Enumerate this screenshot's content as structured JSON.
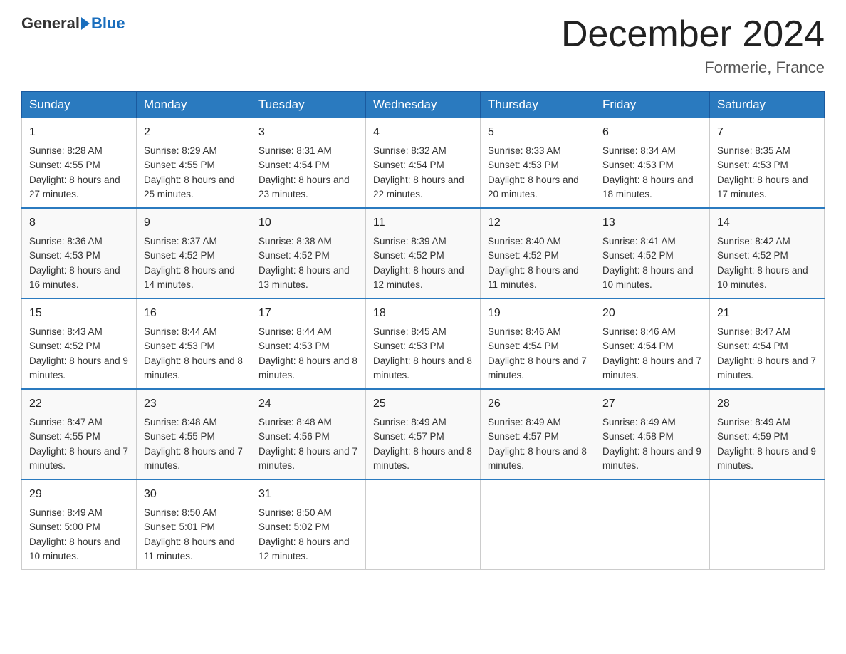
{
  "header": {
    "logo_general": "General",
    "logo_blue": "Blue",
    "month_title": "December 2024",
    "location": "Formerie, France"
  },
  "days_of_week": [
    "Sunday",
    "Monday",
    "Tuesday",
    "Wednesday",
    "Thursday",
    "Friday",
    "Saturday"
  ],
  "weeks": [
    [
      {
        "day": "1",
        "sunrise": "8:28 AM",
        "sunset": "4:55 PM",
        "daylight": "8 hours and 27 minutes."
      },
      {
        "day": "2",
        "sunrise": "8:29 AM",
        "sunset": "4:55 PM",
        "daylight": "8 hours and 25 minutes."
      },
      {
        "day": "3",
        "sunrise": "8:31 AM",
        "sunset": "4:54 PM",
        "daylight": "8 hours and 23 minutes."
      },
      {
        "day": "4",
        "sunrise": "8:32 AM",
        "sunset": "4:54 PM",
        "daylight": "8 hours and 22 minutes."
      },
      {
        "day": "5",
        "sunrise": "8:33 AM",
        "sunset": "4:53 PM",
        "daylight": "8 hours and 20 minutes."
      },
      {
        "day": "6",
        "sunrise": "8:34 AM",
        "sunset": "4:53 PM",
        "daylight": "8 hours and 18 minutes."
      },
      {
        "day": "7",
        "sunrise": "8:35 AM",
        "sunset": "4:53 PM",
        "daylight": "8 hours and 17 minutes."
      }
    ],
    [
      {
        "day": "8",
        "sunrise": "8:36 AM",
        "sunset": "4:53 PM",
        "daylight": "8 hours and 16 minutes."
      },
      {
        "day": "9",
        "sunrise": "8:37 AM",
        "sunset": "4:52 PM",
        "daylight": "8 hours and 14 minutes."
      },
      {
        "day": "10",
        "sunrise": "8:38 AM",
        "sunset": "4:52 PM",
        "daylight": "8 hours and 13 minutes."
      },
      {
        "day": "11",
        "sunrise": "8:39 AM",
        "sunset": "4:52 PM",
        "daylight": "8 hours and 12 minutes."
      },
      {
        "day": "12",
        "sunrise": "8:40 AM",
        "sunset": "4:52 PM",
        "daylight": "8 hours and 11 minutes."
      },
      {
        "day": "13",
        "sunrise": "8:41 AM",
        "sunset": "4:52 PM",
        "daylight": "8 hours and 10 minutes."
      },
      {
        "day": "14",
        "sunrise": "8:42 AM",
        "sunset": "4:52 PM",
        "daylight": "8 hours and 10 minutes."
      }
    ],
    [
      {
        "day": "15",
        "sunrise": "8:43 AM",
        "sunset": "4:52 PM",
        "daylight": "8 hours and 9 minutes."
      },
      {
        "day": "16",
        "sunrise": "8:44 AM",
        "sunset": "4:53 PM",
        "daylight": "8 hours and 8 minutes."
      },
      {
        "day": "17",
        "sunrise": "8:44 AM",
        "sunset": "4:53 PM",
        "daylight": "8 hours and 8 minutes."
      },
      {
        "day": "18",
        "sunrise": "8:45 AM",
        "sunset": "4:53 PM",
        "daylight": "8 hours and 8 minutes."
      },
      {
        "day": "19",
        "sunrise": "8:46 AM",
        "sunset": "4:54 PM",
        "daylight": "8 hours and 7 minutes."
      },
      {
        "day": "20",
        "sunrise": "8:46 AM",
        "sunset": "4:54 PM",
        "daylight": "8 hours and 7 minutes."
      },
      {
        "day": "21",
        "sunrise": "8:47 AM",
        "sunset": "4:54 PM",
        "daylight": "8 hours and 7 minutes."
      }
    ],
    [
      {
        "day": "22",
        "sunrise": "8:47 AM",
        "sunset": "4:55 PM",
        "daylight": "8 hours and 7 minutes."
      },
      {
        "day": "23",
        "sunrise": "8:48 AM",
        "sunset": "4:55 PM",
        "daylight": "8 hours and 7 minutes."
      },
      {
        "day": "24",
        "sunrise": "8:48 AM",
        "sunset": "4:56 PM",
        "daylight": "8 hours and 7 minutes."
      },
      {
        "day": "25",
        "sunrise": "8:49 AM",
        "sunset": "4:57 PM",
        "daylight": "8 hours and 8 minutes."
      },
      {
        "day": "26",
        "sunrise": "8:49 AM",
        "sunset": "4:57 PM",
        "daylight": "8 hours and 8 minutes."
      },
      {
        "day": "27",
        "sunrise": "8:49 AM",
        "sunset": "4:58 PM",
        "daylight": "8 hours and 9 minutes."
      },
      {
        "day": "28",
        "sunrise": "8:49 AM",
        "sunset": "4:59 PM",
        "daylight": "8 hours and 9 minutes."
      }
    ],
    [
      {
        "day": "29",
        "sunrise": "8:49 AM",
        "sunset": "5:00 PM",
        "daylight": "8 hours and 10 minutes."
      },
      {
        "day": "30",
        "sunrise": "8:50 AM",
        "sunset": "5:01 PM",
        "daylight": "8 hours and 11 minutes."
      },
      {
        "day": "31",
        "sunrise": "8:50 AM",
        "sunset": "5:02 PM",
        "daylight": "8 hours and 12 minutes."
      },
      null,
      null,
      null,
      null
    ]
  ],
  "labels": {
    "sunrise": "Sunrise:",
    "sunset": "Sunset:",
    "daylight": "Daylight:"
  }
}
